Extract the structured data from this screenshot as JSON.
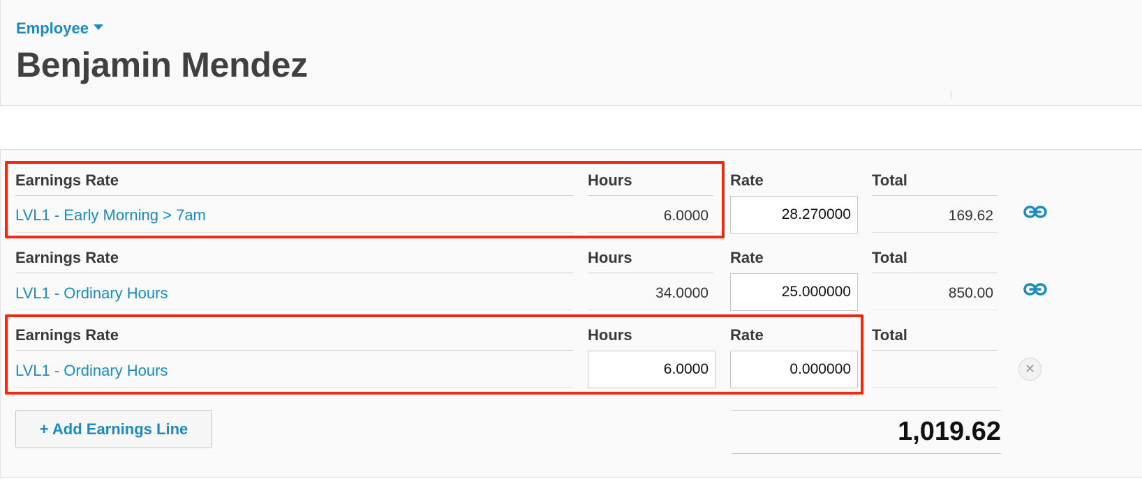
{
  "header": {
    "breadcrumb": "Employee",
    "title": "Benjamin Mendez"
  },
  "columns": {
    "earnings_rate": "Earnings Rate",
    "hours": "Hours",
    "rate": "Rate",
    "total": "Total"
  },
  "lines": [
    {
      "earnings_rate": "LVL1 - Early Morning > 7am",
      "hours": "6.0000",
      "rate": "28.270000",
      "total": "169.62"
    },
    {
      "earnings_rate": "LVL1 - Ordinary Hours",
      "hours": "34.0000",
      "rate": "25.000000",
      "total": "850.00"
    },
    {
      "earnings_rate": "LVL1 - Ordinary Hours",
      "hours": "6.0000",
      "rate": "0.000000",
      "total": ""
    }
  ],
  "add_button": "+ Add Earnings Line",
  "grand_total": "1,019.62",
  "colors": {
    "accent": "#1a8bc2",
    "highlight": "#ee2a12"
  },
  "icons": {
    "row_action_linked": "link-icon",
    "row_action_remove": "close-icon"
  }
}
